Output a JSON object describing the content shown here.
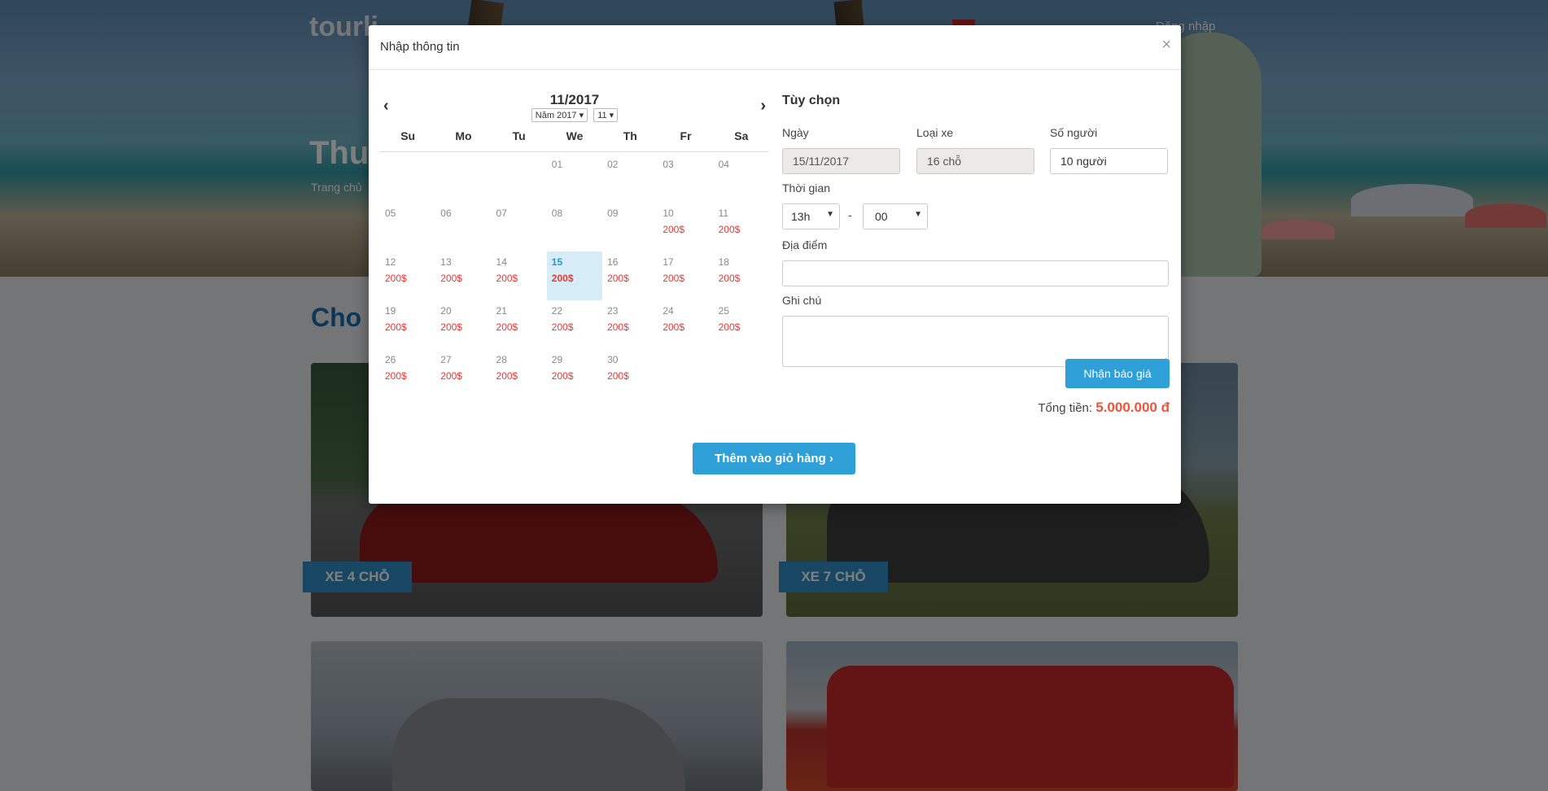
{
  "page": {
    "brand": "tourli",
    "login": "Đăng nhập",
    "hero_title": "Thuê",
    "breadcrumb": "Trang chủ",
    "section_title": "Cho t",
    "cards": [
      {
        "label": "XE 4 CHỖ"
      },
      {
        "label": "XE 7 CHỖ"
      }
    ]
  },
  "modal": {
    "title": "Nhập thông tin",
    "close": "×"
  },
  "calendar": {
    "month_label": "11/2017",
    "year_select": "Năm 2017",
    "month_select": "11",
    "prev_icon": "‹",
    "next_icon": "›",
    "weekdays": [
      "Su",
      "Mo",
      "Tu",
      "We",
      "Th",
      "Fr",
      "Sa"
    ],
    "selected_day": "15",
    "weeks": [
      [
        {
          "d": "",
          "p": ""
        },
        {
          "d": "",
          "p": ""
        },
        {
          "d": "",
          "p": ""
        },
        {
          "d": "01",
          "p": ""
        },
        {
          "d": "02",
          "p": ""
        },
        {
          "d": "03",
          "p": ""
        },
        {
          "d": "04",
          "p": ""
        }
      ],
      [
        {
          "d": "05",
          "p": ""
        },
        {
          "d": "06",
          "p": ""
        },
        {
          "d": "07",
          "p": ""
        },
        {
          "d": "08",
          "p": ""
        },
        {
          "d": "09",
          "p": ""
        },
        {
          "d": "10",
          "p": "200$"
        },
        {
          "d": "11",
          "p": "200$"
        }
      ],
      [
        {
          "d": "12",
          "p": "200$"
        },
        {
          "d": "13",
          "p": "200$"
        },
        {
          "d": "14",
          "p": "200$"
        },
        {
          "d": "15",
          "p": "200$"
        },
        {
          "d": "16",
          "p": "200$"
        },
        {
          "d": "17",
          "p": "200$"
        },
        {
          "d": "18",
          "p": "200$"
        }
      ],
      [
        {
          "d": "19",
          "p": "200$"
        },
        {
          "d": "20",
          "p": "200$"
        },
        {
          "d": "21",
          "p": "200$"
        },
        {
          "d": "22",
          "p": "200$"
        },
        {
          "d": "23",
          "p": "200$"
        },
        {
          "d": "24",
          "p": "200$"
        },
        {
          "d": "25",
          "p": "200$"
        }
      ],
      [
        {
          "d": "26",
          "p": "200$"
        },
        {
          "d": "27",
          "p": "200$"
        },
        {
          "d": "28",
          "p": "200$"
        },
        {
          "d": "29",
          "p": "200$"
        },
        {
          "d": "30",
          "p": "200$"
        },
        {
          "d": "",
          "p": ""
        },
        {
          "d": "",
          "p": ""
        }
      ]
    ]
  },
  "options": {
    "title": "Tùy chọn",
    "date_label": "Ngày",
    "date_value": "15/11/2017",
    "vehicle_label": "Loại xe",
    "vehicle_value": "16 chỗ",
    "people_label": "Số người",
    "people_value": "10 người",
    "time_label": "Thời gian",
    "hour_value": "13h",
    "minute_value": "00",
    "dash": "-",
    "location_label": "Địa điểm",
    "location_value": "",
    "note_label": "Ghi chú",
    "note_value": "",
    "quote_button": "Nhận báo giá",
    "total_label": "Tổng tiền:",
    "total_value": "5.000.000 đ"
  },
  "cart_button": "Thêm vào giỏ hàng ›"
}
